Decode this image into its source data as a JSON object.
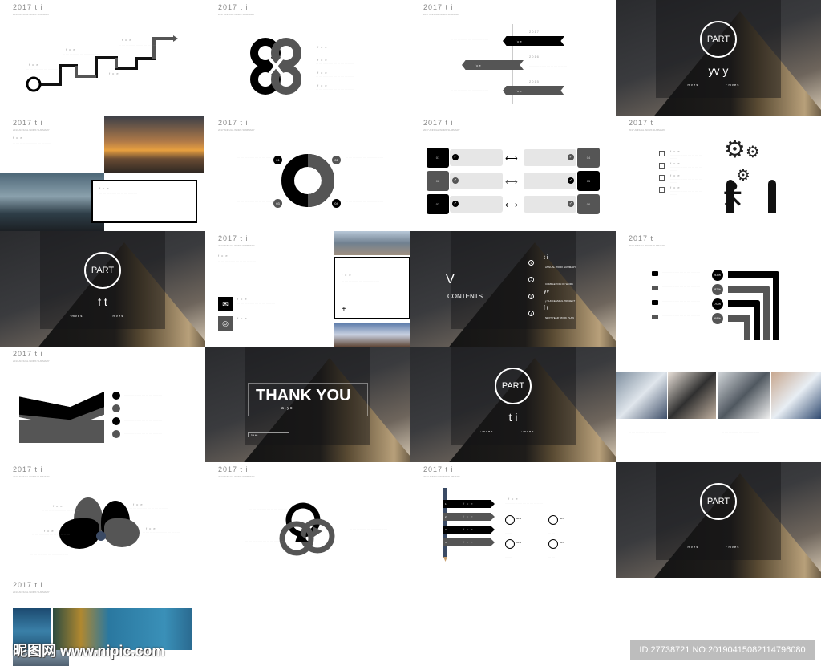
{
  "header": {
    "title": "2017  t     i",
    "subtitle": "2017 ANNUAL WORK SUMMARY",
    "item": "f c e"
  },
  "colors": {
    "black": "#000000",
    "gray": "#595959",
    "light": "#e6e6e6",
    "text": "#888888"
  },
  "stairs": {
    "start": "2017"
  },
  "timeline": {
    "years": [
      "2017",
      "2016",
      "2015"
    ],
    "ribbon": "f c e"
  },
  "part_label": "PART",
  "parts": [
    {
      "title": "yv     y",
      "dots": "· m v e s"
    },
    {
      "title": "f     t",
      "dots": "· m v e s"
    },
    {
      "title": "t          i",
      "dots": "· m v e s"
    },
    {
      "title": "",
      "dots": "· m v e s"
    }
  ],
  "ring": {
    "labels": [
      "01",
      "02",
      "03",
      "04"
    ]
  },
  "boxes": {
    "labels": [
      "01",
      "02",
      "03",
      "04",
      "05",
      "06"
    ]
  },
  "contents": {
    "v": "V",
    "title": "CONTENTS",
    "items": [
      {
        "n": "1",
        "top": "t     i",
        "text": "ANNUAL WORK SUMMARY"
      },
      {
        "n": "2",
        "top": "",
        "text": "COMPLETION OF WORK"
      },
      {
        "n": "3",
        "top": "yv",
        "text": "y SUCCESSFUL PROJECT"
      },
      {
        "n": "4",
        "top": "f    t",
        "text": "NEXT YEAR WORK PLAN"
      }
    ]
  },
  "percents": [
    "93%",
    "82%",
    "70%",
    "68%"
  ],
  "thankyou": {
    "title": "THANK YOU",
    "sub": "a      ,  y c",
    "btn": "l       re  ee"
  },
  "pencil": {
    "steps": [
      "1",
      "2",
      "3",
      "4"
    ],
    "stats": [
      "80%",
      "60%",
      "65%",
      "55%"
    ]
  },
  "watermark": {
    "logo": "昵图网 www.nipic.com",
    "id": "ID:27738721 NO:20190415082114796080"
  }
}
